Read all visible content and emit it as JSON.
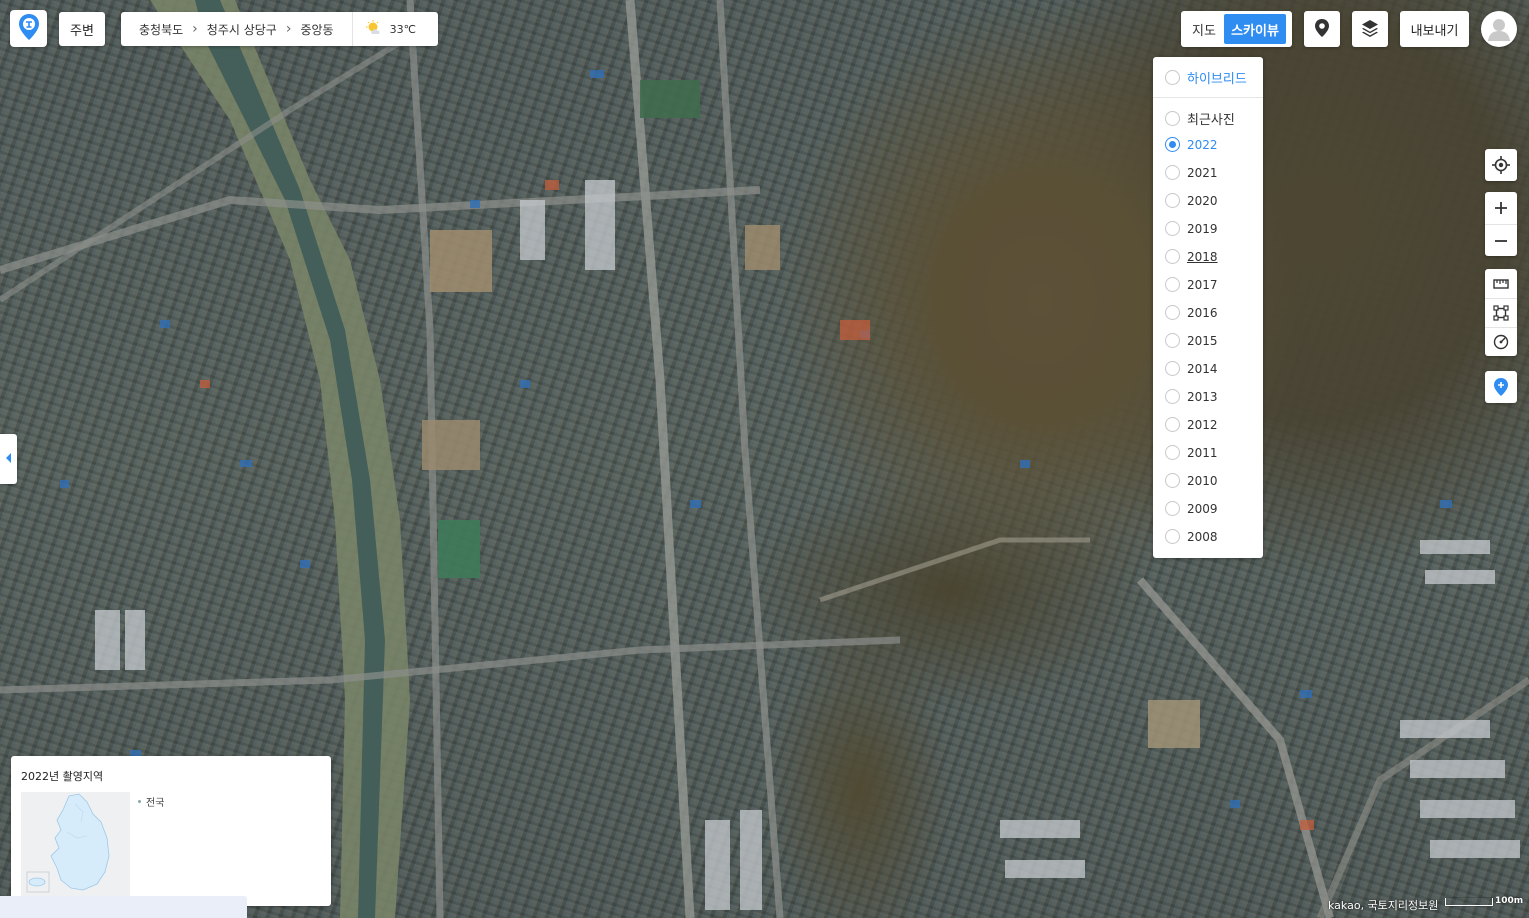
{
  "app": {
    "logo_icon": "kakao-map-pin-logo",
    "around_label": "주변"
  },
  "breadcrumb": {
    "items": [
      "충청북도",
      "청주시 상당구",
      "중앙동"
    ],
    "weather_icon": "sun-cloud-icon",
    "temperature": "33℃"
  },
  "map_type": {
    "map_label": "지도",
    "skyview_label": "스카이뷰",
    "selected": "스카이뷰"
  },
  "toolbar": {
    "roadview_icon": "roadview-pin-icon",
    "layers_icon": "layers-icon",
    "export_label": "내보내기",
    "profile_icon": "user-icon"
  },
  "year_panel": {
    "hybrid_label": "하이브리드",
    "latest_label": "최근사진",
    "years": [
      "2022",
      "2021",
      "2020",
      "2019",
      "2018",
      "2017",
      "2016",
      "2015",
      "2014",
      "2013",
      "2012",
      "2011",
      "2010",
      "2009",
      "2008"
    ],
    "selected_year": "2022",
    "hovered_year": "2018"
  },
  "right_controls": {
    "locate_icon": "my-location-icon",
    "zoom_in_icon": "plus-icon",
    "zoom_out_icon": "minus-icon",
    "ruler_icon": "ruler-icon",
    "area_icon": "area-measure-icon",
    "radius_icon": "radius-measure-icon",
    "add_place_icon": "add-place-pin-icon"
  },
  "coverage": {
    "title": "2022년 촬영지역",
    "legend": "전국"
  },
  "footer": {
    "copyright": "kakao, 국토지리정보원",
    "scale_label": "100m"
  },
  "colors": {
    "accent": "#2f8cf1",
    "panel_bg": "#ffffff",
    "korea_fill": "#d7ecfb"
  }
}
